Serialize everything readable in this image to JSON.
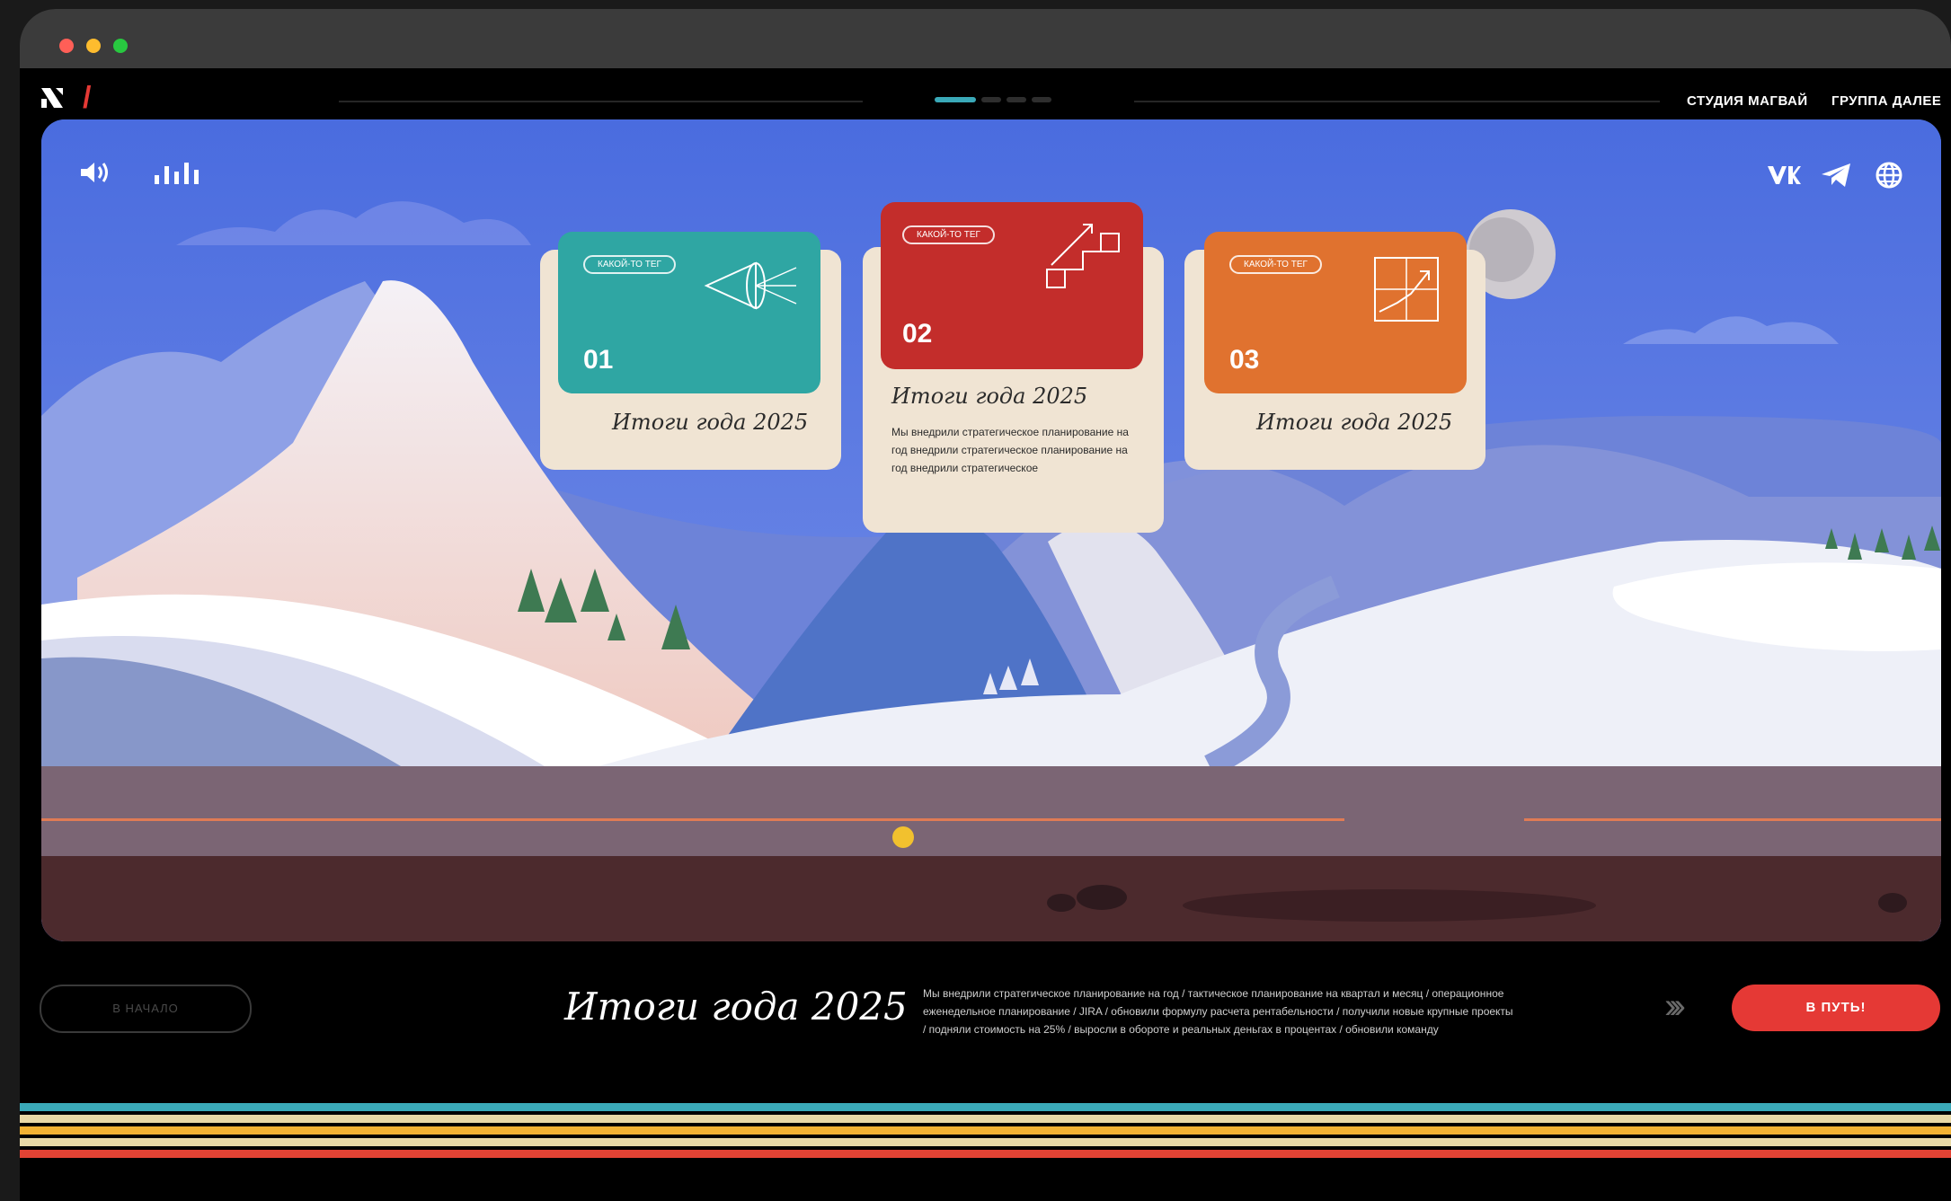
{
  "window": {
    "traffic_lights": [
      "#ff5f57",
      "#febc2e",
      "#28c840"
    ]
  },
  "nav": {
    "logo_icon": "brand-logo-icon",
    "progress_segments": 4,
    "links": [
      "СТУДИЯ МАГВАЙ",
      "ГРУППА ДАЛЕЕ"
    ]
  },
  "scene": {
    "controls": {
      "sound_icon": "speaker-icon",
      "equalizer_icon": "equalizer-icon"
    },
    "social": [
      "vk-icon",
      "telegram-icon",
      "globe-icon"
    ],
    "cards": [
      {
        "number": "01",
        "tag": "КАКОЙ-ТО ТЕГ",
        "title": "Итоги года 2025",
        "icon": "telescope-icon",
        "color": "#2fa6a3"
      },
      {
        "number": "02",
        "tag": "КАКОЙ-ТО ТЕГ",
        "title": "Итоги года 2025",
        "icon": "stairs-arrow-icon",
        "color": "#c32d2b",
        "description": "Мы внедрили стратегическое планирование на год внедрили стратегическое планирование на год внедрили стратегическое"
      },
      {
        "number": "03",
        "tag": "КАКОЙ-ТО ТЕГ",
        "title": "Итоги года 2025",
        "icon": "growth-chart-icon",
        "color": "#e0722f"
      }
    ],
    "progress_marker_color": "#f2c12e"
  },
  "bottom": {
    "start_button": "В НАЧАЛО",
    "title": "Итоги года 2025",
    "description": "Мы внедрили стратегическое планирование на год / тактическое планирование на квартал и месяц / операционное еженедельное планирование / JIRA / обновили формулу расчета рентабельности / получили новые крупные проекты / подняли стоимость на 25% / выросли в обороте и реальных деньгах в процентах / обновили команду",
    "go_button": "В ПУТЬ!",
    "arrows": "›››"
  },
  "stripes": [
    "#3aa9b8",
    "#e9d9a6",
    "#f2b233",
    "#e9d9a6",
    "#e24334"
  ]
}
